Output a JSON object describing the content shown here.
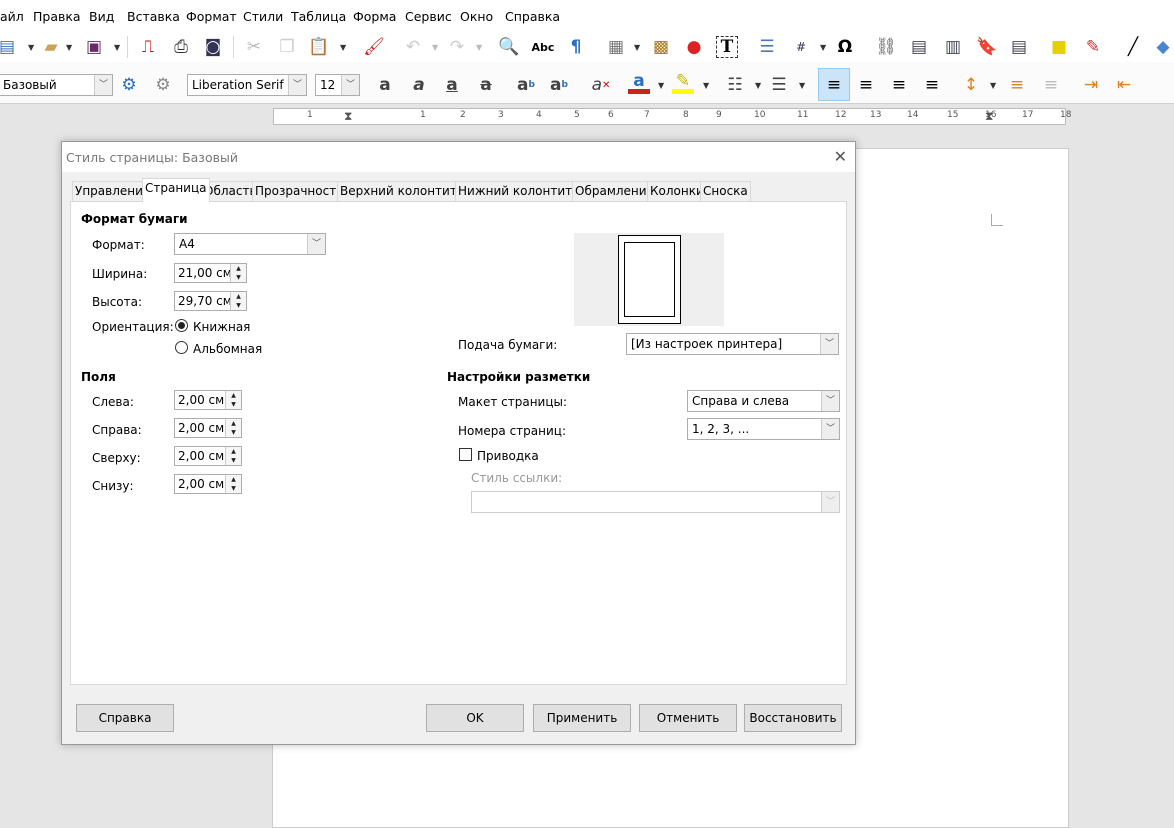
{
  "menu": [
    "айл",
    "Правка",
    "Вид",
    "Вставка",
    "Формат",
    "Стили",
    "Таблица",
    "Форма",
    "Сервис",
    "Окно",
    "Справка"
  ],
  "toolbar": {
    "paragraph_style": "Базовый",
    "font_name": "Liberation Serif",
    "font_size": "12",
    "font_color": "#c9211e",
    "highlight_color": "#ffff00"
  },
  "ruler": {
    "ticks": [
      "1",
      "1",
      "2",
      "3",
      "4",
      "5",
      "6",
      "7",
      "8",
      "9",
      "10",
      "11",
      "12",
      "13",
      "14",
      "15",
      "16",
      "17",
      "18"
    ]
  },
  "dialog": {
    "title": "Стиль страницы: Базовый",
    "tabs": [
      "Управление",
      "Страница",
      "Область",
      "Прозрачность",
      "Верхний колонтитул",
      "Нижний колонтитул",
      "Обрамление",
      "Колонки",
      "Сноска"
    ],
    "active_tab": "Страница",
    "paper": {
      "heading": "Формат бумаги",
      "format_label": "Формат:",
      "format_value": "A4",
      "width_label": "Ширина:",
      "width_value": "21,00 см",
      "height_label": "Высота:",
      "height_value": "29,70 см",
      "orientation_label": "Ориентация:",
      "portrait": "Книжная",
      "landscape": "Альбомная",
      "orientation_selected": "Книжная",
      "tray_label": "Подача бумаги:",
      "tray_value": "[Из настроек принтера]"
    },
    "margins": {
      "heading": "Поля",
      "left_label": "Слева:",
      "left_value": "2,00 см",
      "right_label": "Справа:",
      "right_value": "2,00 см",
      "top_label": "Сверху:",
      "top_value": "2,00 см",
      "bottom_label": "Снизу:",
      "bottom_value": "2,00 см"
    },
    "layout": {
      "heading": "Настройки разметки",
      "page_layout_label": "Макет страницы:",
      "page_layout_value": "Справа и слева",
      "numbers_label": "Номера страниц:",
      "numbers_value": "1, 2, 3, ...",
      "register_label": "Приводка",
      "register_checked": false,
      "ref_style_label": "Стиль ссылки:",
      "ref_style_value": ""
    },
    "buttons": {
      "help": "Справка",
      "ok": "OK",
      "apply": "Применить",
      "cancel": "Отменить",
      "reset": "Восстановить"
    }
  }
}
